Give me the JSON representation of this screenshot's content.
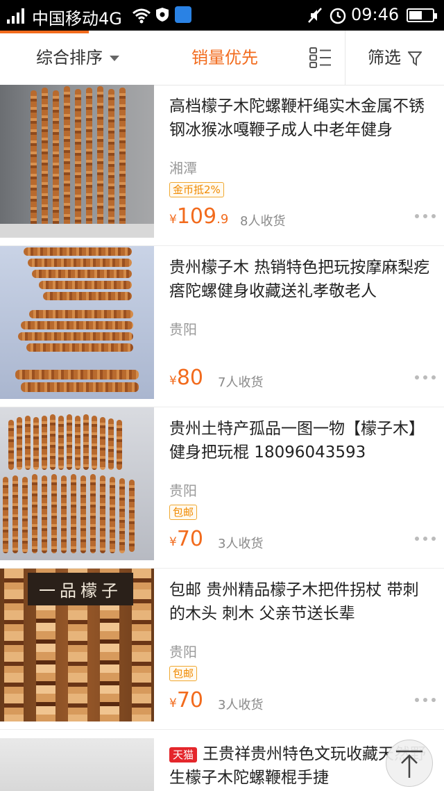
{
  "status_bar": {
    "carrier": "中国移动4G",
    "time": "09:46",
    "signal_icon": "signal-bars-icon",
    "wifi_icon": "wifi-icon",
    "battery_level": 0.55
  },
  "sort_bar": {
    "comprehensive": "综合排序",
    "sales_first": "销量优先",
    "filter": "筛选",
    "active_color": "#f26b1d"
  },
  "products": [
    {
      "title": "高档檬子木陀螺鞭杆绳实木金属不锈钢冰猴冰嘎鞭子成人中老年健身",
      "location": "湘潭",
      "tag": "金币抵2%",
      "price_symbol": "¥",
      "price_int": "109",
      "price_dec": ".9",
      "sold": "8人收货"
    },
    {
      "title": "贵州檬子木 热销特色把玩按摩麻梨疙瘩陀螺健身收藏送礼孝敬老人",
      "location": "贵阳",
      "tag": "",
      "price_symbol": "¥",
      "price_int": "80",
      "price_dec": "",
      "sold": "7人收货"
    },
    {
      "title": "贵州土特产孤品一图一物【檬子木】健身把玩棍 18096043593",
      "location": "贵阳",
      "tag": "包邮",
      "price_symbol": "¥",
      "price_int": "70",
      "price_dec": "",
      "sold": "3人收货"
    },
    {
      "title": "包邮 贵州精品檬子木把件拐杖 带刺的木头 刺木 父亲节送长辈",
      "location": "贵阳",
      "tag": "包邮",
      "price_symbol": "¥",
      "price_int": "70",
      "price_dec": "",
      "sold": "3人收货",
      "image_caption": "一品檬子"
    },
    {
      "tmall_badge": "天猫",
      "title": "王贵祥贵州特色文玩收藏天然野生檬子木陀螺鞭棍手捷"
    }
  ],
  "brand_colors": {
    "price": "#f26b1d",
    "tag_border": "#f0a830",
    "tmall": "#e4262b"
  }
}
